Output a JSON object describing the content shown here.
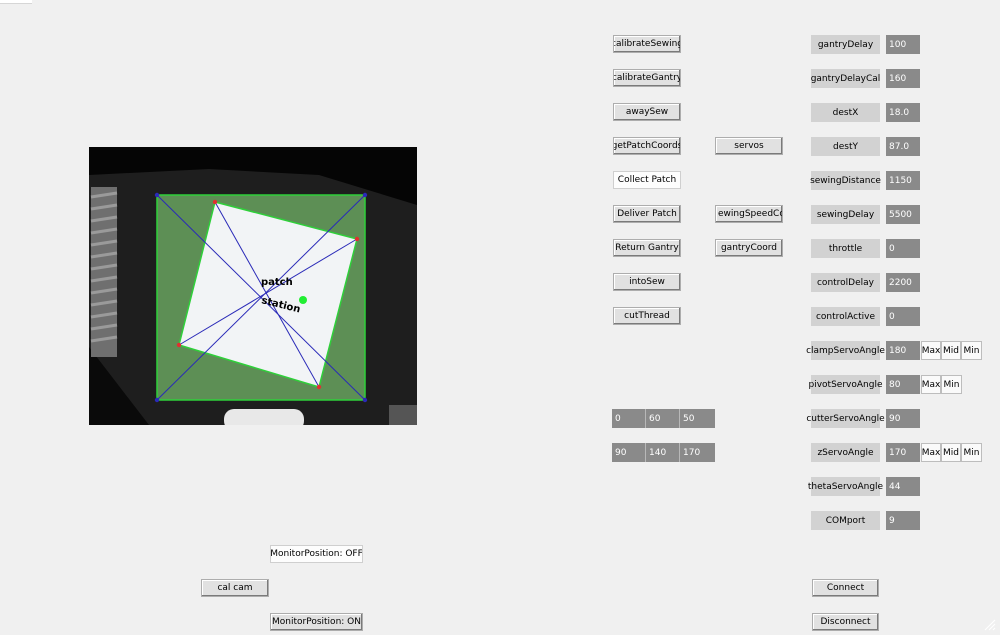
{
  "topbar": {
    "blank_tab": ""
  },
  "camera": {
    "overlay_label_line1": "patch",
    "overlay_label_line2": "station",
    "colors": {
      "patch_region": "#5d8f55",
      "patch": "#f2f4f6",
      "outline": "#2fd03a",
      "lines": "#2a2ab8",
      "center": "#22ee33"
    }
  },
  "commands": {
    "calibrateSewing": "calibrateSewing",
    "calibrateGantry": "calibrateGantry",
    "awaySew": "awaySew",
    "getPatchCoords": "getPatchCoords",
    "collectPatch": "Collect Patch",
    "deliverPatch": "Deliver Patch",
    "returnGantry": "Return Gantry",
    "intoSew": "intoSew",
    "cutThread": "cutThread",
    "servos": "servos",
    "sewingSpeedControl": "ewingSpeedContro",
    "gantryCoord": "gantryCoord"
  },
  "servo_rows": [
    [
      "0",
      "60",
      "50"
    ],
    [
      "90",
      "140",
      "170"
    ]
  ],
  "params": [
    {
      "label": "gantryDelay",
      "value": "100"
    },
    {
      "label": "gantryDelayCal",
      "value": "160"
    },
    {
      "label": "destX",
      "value": "18.0"
    },
    {
      "label": "destY",
      "value": "87.0"
    },
    {
      "label": "sewingDistance",
      "value": "1150"
    },
    {
      "label": "sewingDelay",
      "value": "5500"
    },
    {
      "label": "throttle",
      "value": "0"
    },
    {
      "label": "controlDelay",
      "value": "2200"
    },
    {
      "label": "controlActive",
      "value": "0"
    },
    {
      "label": "clampServoAngle",
      "value": "180"
    },
    {
      "label": "pivotServoAngle",
      "value": "80"
    },
    {
      "label": "cutterServoAngle",
      "value": "90"
    },
    {
      "label": "zServoAngle",
      "value": "170"
    },
    {
      "label": "thetaServoAngle",
      "value": "44"
    },
    {
      "label": "COMport",
      "value": "9"
    }
  ],
  "presets": {
    "max": "Max",
    "mid": "Mid",
    "min": "Min"
  },
  "bottom": {
    "monitorOff": "MonitorPosition: OFF",
    "calCam": "cal cam",
    "monitorOn": "MonitorPosition: ON",
    "connect": "Connect",
    "disconnect": "Disconnect"
  }
}
